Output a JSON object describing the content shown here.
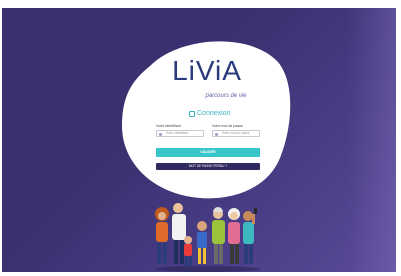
{
  "brand": {
    "logo_text": "LiViA",
    "tagline": "parcours de vie"
  },
  "login": {
    "heading": "Connexion",
    "identifier_label": "Votre identifiant",
    "identifier_placeholder": "Votre identifiant",
    "password_label": "Votre mot de passe",
    "password_placeholder": "Votre mot de passe",
    "submit_label": "VALIDER",
    "forgot_label": "MOT DE PASSE PERDU ?"
  },
  "colors": {
    "background": "#3b2f70",
    "accent": "#38c6c9",
    "brand": "#2b3a7d",
    "secondary_button": "#2f2a60"
  },
  "illustration": {
    "name": "family-group-illustration"
  }
}
